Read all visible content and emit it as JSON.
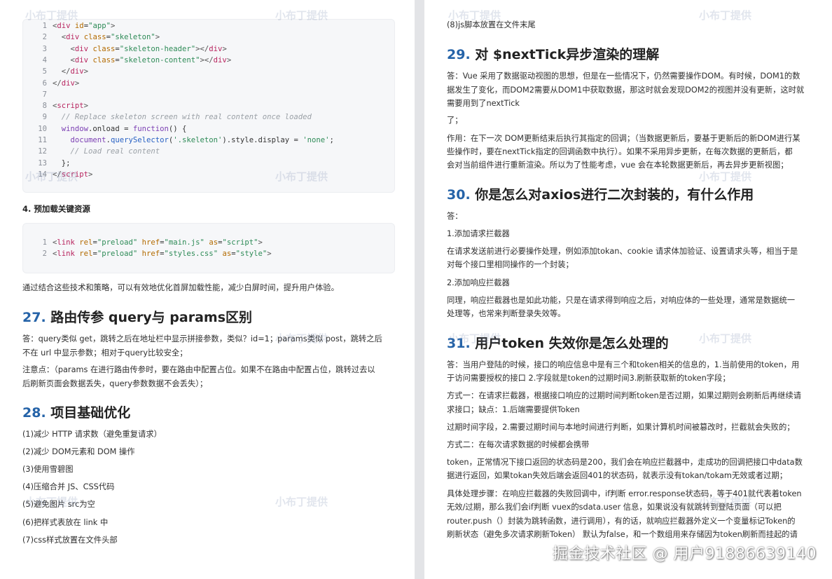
{
  "left": {
    "code1": [
      {
        "n": "1",
        "html": "<span class='punc'>&lt;</span><span class='tag'>div</span> <span class='attr'>id</span>=<span class='str'>\"app\"</span><span class='punc'>&gt;</span>"
      },
      {
        "n": "2",
        "html": "  <span class='punc'>&lt;</span><span class='tag'>div</span> <span class='attr'>class</span>=<span class='str'>\"skeleton\"</span><span class='punc'>&gt;</span>"
      },
      {
        "n": "3",
        "html": "    <span class='punc'>&lt;</span><span class='tag'>div</span> <span class='attr'>class</span>=<span class='str'>\"skeleton-header\"</span><span class='punc'>&gt;&lt;/</span><span class='tag'>div</span><span class='punc'>&gt;</span>"
      },
      {
        "n": "4",
        "html": "    <span class='punc'>&lt;</span><span class='tag'>div</span> <span class='attr'>class</span>=<span class='str'>\"skeleton-content\"</span><span class='punc'>&gt;&lt;/</span><span class='tag'>div</span><span class='punc'>&gt;</span>"
      },
      {
        "n": "5",
        "html": "  <span class='punc'>&lt;/</span><span class='tag'>div</span><span class='punc'>&gt;</span>"
      },
      {
        "n": "6",
        "html": "<span class='punc'>&lt;/</span><span class='tag'>div</span><span class='punc'>&gt;</span>"
      },
      {
        "n": "7",
        "html": ""
      },
      {
        "n": "8",
        "html": "<span class='punc'>&lt;</span><span class='tag'>script</span><span class='punc'>&gt;</span>"
      },
      {
        "n": "9",
        "html": "  <span class='cm'>// Replace skeleton screen with real content once loaded</span>"
      },
      {
        "n": "10",
        "html": "  <span class='kw'>window</span>.onload = <span class='kw'>function</span>() {"
      },
      {
        "n": "11",
        "html": "    <span class='kw'>document</span>.<span class='fn'>querySelector</span>(<span class='str'>'.skeleton'</span>).style.display = <span class='str'>'none'</span>;"
      },
      {
        "n": "12",
        "html": "    <span class='cm'>// Load real content</span>"
      },
      {
        "n": "13",
        "html": "  };"
      },
      {
        "n": "14",
        "html": "<span class='punc'>&lt;/</span><span class='tag'>script</span><span class='punc'>&gt;</span>"
      }
    ],
    "section4_title": "4. 预加载关键资源",
    "code2": [
      {
        "n": "1",
        "html": "<span class='punc'>&lt;</span><span class='tag'>link</span> <span class='attr'>rel</span>=<span class='str'>\"preload\"</span> <span class='attr'>href</span>=<span class='str'>\"main.js\"</span> <span class='attr'>as</span>=<span class='str'>\"script\"</span><span class='punc'>&gt;</span>"
      },
      {
        "n": "2",
        "html": "<span class='punc'>&lt;</span><span class='tag'>link</span> <span class='attr'>rel</span>=<span class='str'>\"preload\"</span> <span class='attr'>href</span>=<span class='str'>\"styles.css\"</span> <span class='attr'>as</span>=<span class='str'>\"style\"</span><span class='punc'>&gt;</span>"
      }
    ],
    "summary": "通过结合这些技术和策略，可以有效地优化首屏加载性能，减少白屏时间，提升用户体验。",
    "h27_num": "27.",
    "h27_title": "路由传参 query与 params区别",
    "p27_1a": "答：query类似 get，跳转之后在地址栏中显示拼接参数，类似？id=1；params类似 post，跳转之后",
    "p27_1b": "不在 url 中显示参数；相对于query比较安全；",
    "p27_2a": "注意点：（params 在进行路由传参时，要在路由中配置占位。如果不在路由中配置占位，跳转过去以",
    "p27_2b": "后刷新页面会数据丢失，query参数数据不会丢失）；",
    "h28_num": "28.",
    "h28_title": "项目基础优化",
    "opt": [
      "(1)减少 HTTP 请求数（避免重复请求）",
      "(2)减少 DOM元素和 DOM 操作",
      "(3)使用雪碧图",
      "(4)压缩合并 JS、CSS代码",
      "(5)避免图片 src为空",
      "(6)把样式表放在 link 中",
      "(7)css样式放置在文件头部"
    ]
  },
  "right": {
    "top_line": "(8)js脚本放置在文件末尾",
    "h29_num": "29.",
    "h29_title": "对 $nextTick异步渲染的理解",
    "p29": [
      "答：Vue 采用了数据驱动视图的思想，但是在一些情况下，仍然需要操作DOM。有时候，DOM1的数",
      "据发生了变化，而DOM2需要从DOM1中获取数据，那这时就会发现DOM2的视图并没有更新，这时就",
      "需要用到了nextTick",
      "了；",
      "作用：在下一次 DOM更新结束后执行其指定的回调；（当数据更新后，要基于更新后的新DOM进行某",
      "些操作时，要在nextTick指定的回调函数中执行）。如果不采用异步更新，在每次数据的更新后，都",
      "会对当前组件进行重新渲染。所以为了性能考虑，vue 会在本轮数据更新后，再去异步更新视图；"
    ],
    "h30_num": "30.",
    "h30_title": "你是怎么对axios进行二次封装的，有什么作用",
    "p30": [
      "答：",
      "1.添加请求拦截器",
      "在请求发送前进行必要操作处理，例如添加tokan、cookie 请求体加验证、设置请求头等，相当于是",
      "对每个接口里相同操作的一个封装；",
      "2.添加响应拦截器",
      "同理，响应拦截器也是如此功能，只是在请求得到响应之后，对响应体的一些处理，通常是数据统一",
      "处理等，也常来判断登录失效等。"
    ],
    "h31_num": "31.",
    "h31_title": "用户token 失效你是怎么处理的",
    "p31": [
      "答：当用户登陆的时候，接口的响应信息中是有三个和token相关的信息的，1.当前使用的token，用",
      "于访问需要授权的接口 2.字段就是token的过期时间3.刷新获取新的token字段；",
      "方式一：在请求拦截器，根据接口响应的过期时间判断token是否过期，如果过期则会刷新后再继续请",
      "求接口；缺点：1.后端需要提供Token",
      "过期时间字段，2.需要过期时间与本地时间进行判断，如果计算机时间被篡改时，拦截就会失败的；",
      "方式二：在每次请求数据的时候都会携带",
      "token，正常情况下接口返回的状态码是200，我们会在响应拦截器中，走成功的回调把接口中data数",
      "据进行返回，如果tokan失效后端会返回401的状态码，就表示没有tokan/tokam无效或者过期；",
      "具体处理步骤：在响应拦截器的失败回调中，if判断 error.response状态码，等于401就代表着token",
      "无效/过期，那么我们会if判断 vuex的sdata.user 信息，如果说没有就跳转到登陆页面（可以把",
      "router.push（）封装为跳转函数，进行调用），有的话，就响应拦截器外定义一个变量标记Token的",
      "刷新状态（避免多次请求刷新Token） 默认为false，和一个数组用来存储因为token刷新而挂起的请"
    ]
  },
  "watermark_text": "小布丁提供",
  "footer_watermark": "掘金技术社区 @ 用户91886639140"
}
